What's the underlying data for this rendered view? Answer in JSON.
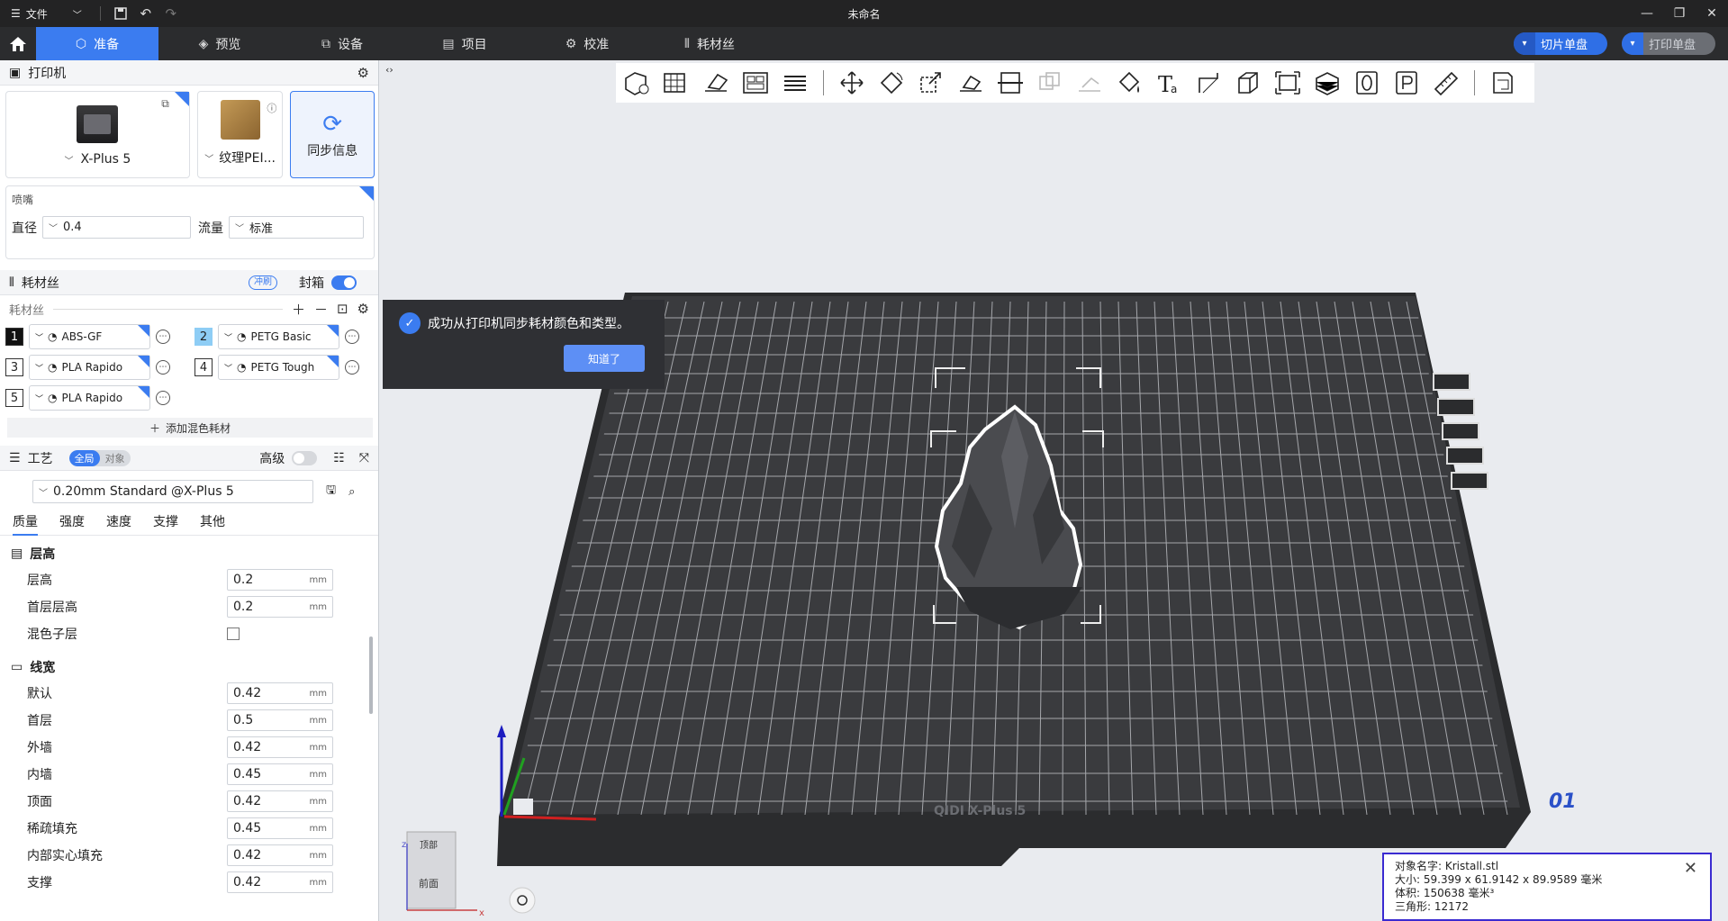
{
  "titlebar": {
    "file_label": "文件",
    "title": "未命名"
  },
  "tabs": [
    {
      "label": "准备",
      "icon": "cube-icon"
    },
    {
      "label": "预览",
      "icon": "layers-icon"
    },
    {
      "label": "设备",
      "icon": "device-icon"
    },
    {
      "label": "项目",
      "icon": "project-icon"
    },
    {
      "label": "校准",
      "icon": "calibrate-icon"
    },
    {
      "label": "耗材丝",
      "icon": "filament-icon"
    }
  ],
  "actions": {
    "slice_label": "切片单盘",
    "print_label": "打印单盘"
  },
  "printer": {
    "section_title": "打印机",
    "model": "X-Plus 5",
    "plate": "纹理PEI...",
    "sync_label": "同步信息",
    "nozzle_title": "喷嘴",
    "diameter_label": "直径",
    "diameter_value": "0.4",
    "flow_label": "流量",
    "flow_value": "标准"
  },
  "filament": {
    "section_title": "耗材丝",
    "flush_label": "冲刷",
    "enclosure_label": "封箱",
    "sub_title": "耗材丝",
    "items": [
      {
        "num": "1",
        "name": "ABS-GF",
        "color": "#111111"
      },
      {
        "num": "2",
        "name": "PETG Basic",
        "color": "#8ecdf5"
      },
      {
        "num": "3",
        "name": "PLA Rapido",
        "color": "#ffffff"
      },
      {
        "num": "4",
        "name": "PETG Tough",
        "color": "#ffffff"
      },
      {
        "num": "5",
        "name": "PLA Rapido",
        "color": "#ffffff"
      }
    ],
    "add_mix_label": "添加混色耗材"
  },
  "process": {
    "section_title": "工艺",
    "seg_global": "全局",
    "seg_object": "对象",
    "advanced_label": "高级",
    "preset": "0.20mm Standard @X-Plus 5",
    "tabs": [
      "质量",
      "强度",
      "速度",
      "支撑",
      "其他"
    ],
    "groups": [
      {
        "title": "层高",
        "rows": [
          {
            "label": "层高",
            "value": "0.2",
            "unit": "mm"
          },
          {
            "label": "首层层高",
            "value": "0.2",
            "unit": "mm"
          },
          {
            "label": "混色子层",
            "value": "",
            "unit": "",
            "checkbox": true
          }
        ]
      },
      {
        "title": "线宽",
        "rows": [
          {
            "label": "默认",
            "value": "0.42",
            "unit": "mm"
          },
          {
            "label": "首层",
            "value": "0.5",
            "unit": "mm"
          },
          {
            "label": "外墙",
            "value": "0.42",
            "unit": "mm"
          },
          {
            "label": "内墙",
            "value": "0.45",
            "unit": "mm"
          },
          {
            "label": "顶面",
            "value": "0.42",
            "unit": "mm"
          },
          {
            "label": "稀疏填充",
            "value": "0.45",
            "unit": "mm"
          },
          {
            "label": "内部实心填充",
            "value": "0.42",
            "unit": "mm"
          },
          {
            "label": "支撑",
            "value": "0.42",
            "unit": "mm"
          }
        ]
      }
    ]
  },
  "toast": {
    "message": "成功从打印机同步耗材颜色和类型。",
    "button": "知道了"
  },
  "scene": {
    "plate_brand": "QIDI  X-Plus 5",
    "plate_number": "01",
    "cube_top": "顶部",
    "cube_front": "前面",
    "axis_x": "x",
    "axis_z": "z"
  },
  "info": {
    "name_label": "对象名字:",
    "name_value": "Kristall.stl",
    "size_label": "大小:",
    "size_value": "59.399 x 61.9142 x 89.9589 毫米",
    "volume_label": "体积:",
    "volume_value": "150638 毫米³",
    "tri_label": "三角形:",
    "tri_value": "12172"
  }
}
